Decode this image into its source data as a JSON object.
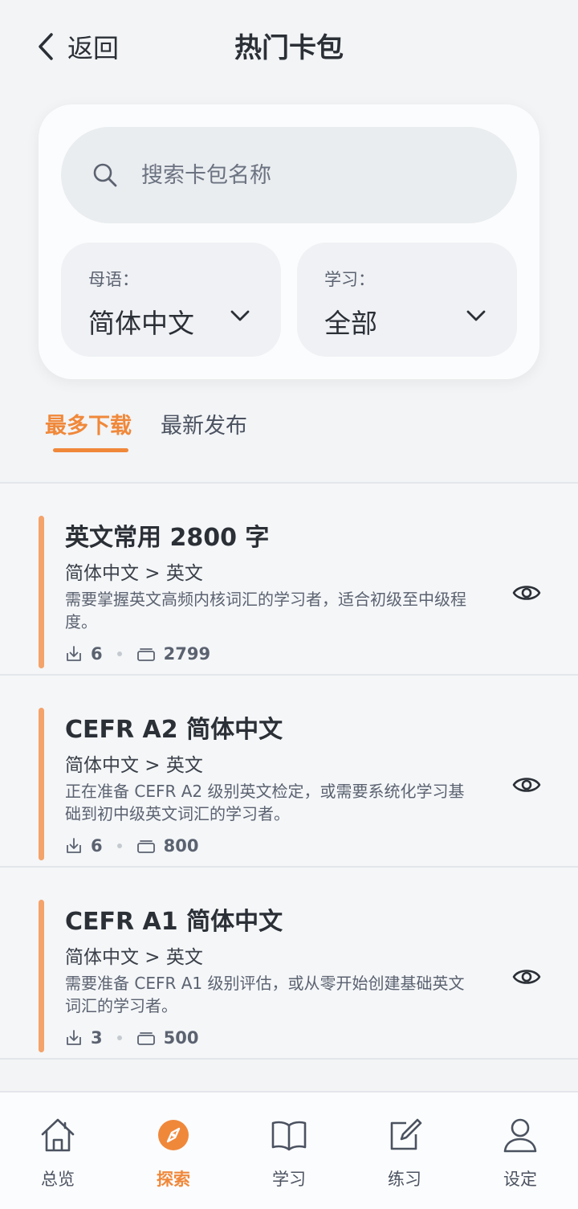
{
  "header": {
    "back_label": "返回",
    "title": "热门卡包"
  },
  "search": {
    "placeholder": "搜索卡包名称"
  },
  "filters": {
    "native": {
      "label": "母语：",
      "value": "简体中文"
    },
    "learning": {
      "label": "学习：",
      "value": "全部"
    }
  },
  "tabs": [
    {
      "label": "最多下载",
      "active": true
    },
    {
      "label": "最新发布",
      "active": false
    }
  ],
  "packs": [
    {
      "name": "英文常用 2800 字",
      "langs": "简体中文 > 英文",
      "description": "需要掌握英文高频内核词汇的学习者，适合初级至中级程度。",
      "downloads": "6",
      "cards": "2799"
    },
    {
      "name": "CEFR A2 简体中文",
      "langs": "简体中文 > 英文",
      "description": "正在准备 CEFR A2 级别英文检定，或需要系统化学习基础到初中级英文词汇的学习者。",
      "downloads": "6",
      "cards": "800"
    },
    {
      "name": "CEFR A1 简体中文",
      "langs": "简体中文 > 英文",
      "description": "需要准备 CEFR A1 级别评估，或从零开始创建基础英文词汇的学习者。",
      "downloads": "3",
      "cards": "500"
    }
  ],
  "bottom_nav": [
    {
      "label": "总览",
      "icon": "home-icon",
      "active": false
    },
    {
      "label": "探索",
      "icon": "compass-icon",
      "active": true
    },
    {
      "label": "学习",
      "icon": "book-icon",
      "active": false
    },
    {
      "label": "练习",
      "icon": "edit-icon",
      "active": false
    },
    {
      "label": "设定",
      "icon": "user-icon",
      "active": false
    }
  ],
  "colors": {
    "accent": "#f0883a",
    "pack_bar": "#f4a36a",
    "background": "#f2f4f6"
  }
}
